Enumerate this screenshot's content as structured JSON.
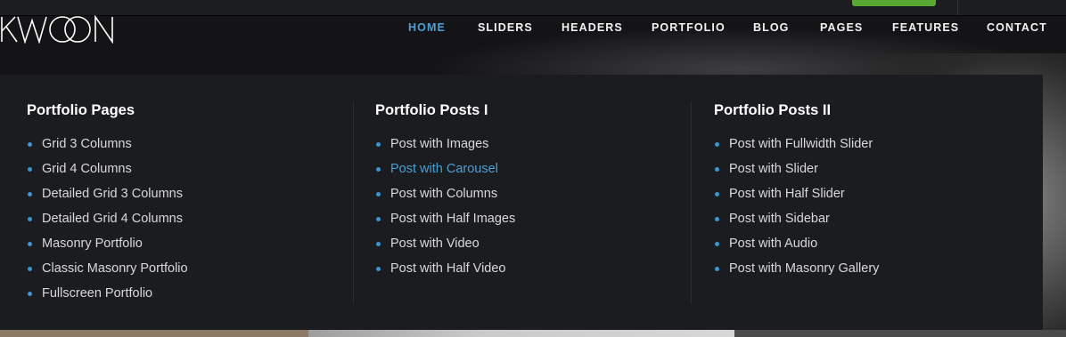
{
  "brand": {
    "logo_text": "KWOON"
  },
  "colors": {
    "accent": "#4a9fd5",
    "bullet": "#3b95cf",
    "cta_green": "#59a834",
    "panel_bg": "#1b1c1f"
  },
  "nav": {
    "items": [
      {
        "label": "HOME",
        "active": true
      },
      {
        "label": "SLIDERS",
        "active": false
      },
      {
        "label": "HEADERS",
        "active": false
      },
      {
        "label": "PORTFOLIO",
        "active": false
      },
      {
        "label": "BLOG",
        "active": false
      },
      {
        "label": "PAGES",
        "active": false
      },
      {
        "label": "FEATURES",
        "active": false
      },
      {
        "label": "CONTACT",
        "active": false
      }
    ]
  },
  "mega_menu": {
    "columns": [
      {
        "title": "Portfolio Pages",
        "items": [
          "Grid 3 Columns",
          "Grid 4 Columns",
          "Detailed Grid 3 Columns",
          "Detailed Grid 4 Columns",
          "Masonry Portfolio",
          "Classic Masonry Portfolio",
          "Fullscreen Portfolio"
        ]
      },
      {
        "title": "Portfolio Posts I",
        "items": [
          "Post with Images",
          "Post with Carousel",
          "Post with Columns",
          "Post with Half Images",
          "Post with Video",
          "Post with Half Video"
        ],
        "highlighted": "Post with Carousel"
      },
      {
        "title": "Portfolio Posts II",
        "items": [
          "Post with Fullwidth Slider",
          "Post with Slider",
          "Post with Half Slider",
          "Post with Sidebar",
          "Post with Audio",
          "Post with Masonry Gallery"
        ]
      }
    ]
  }
}
